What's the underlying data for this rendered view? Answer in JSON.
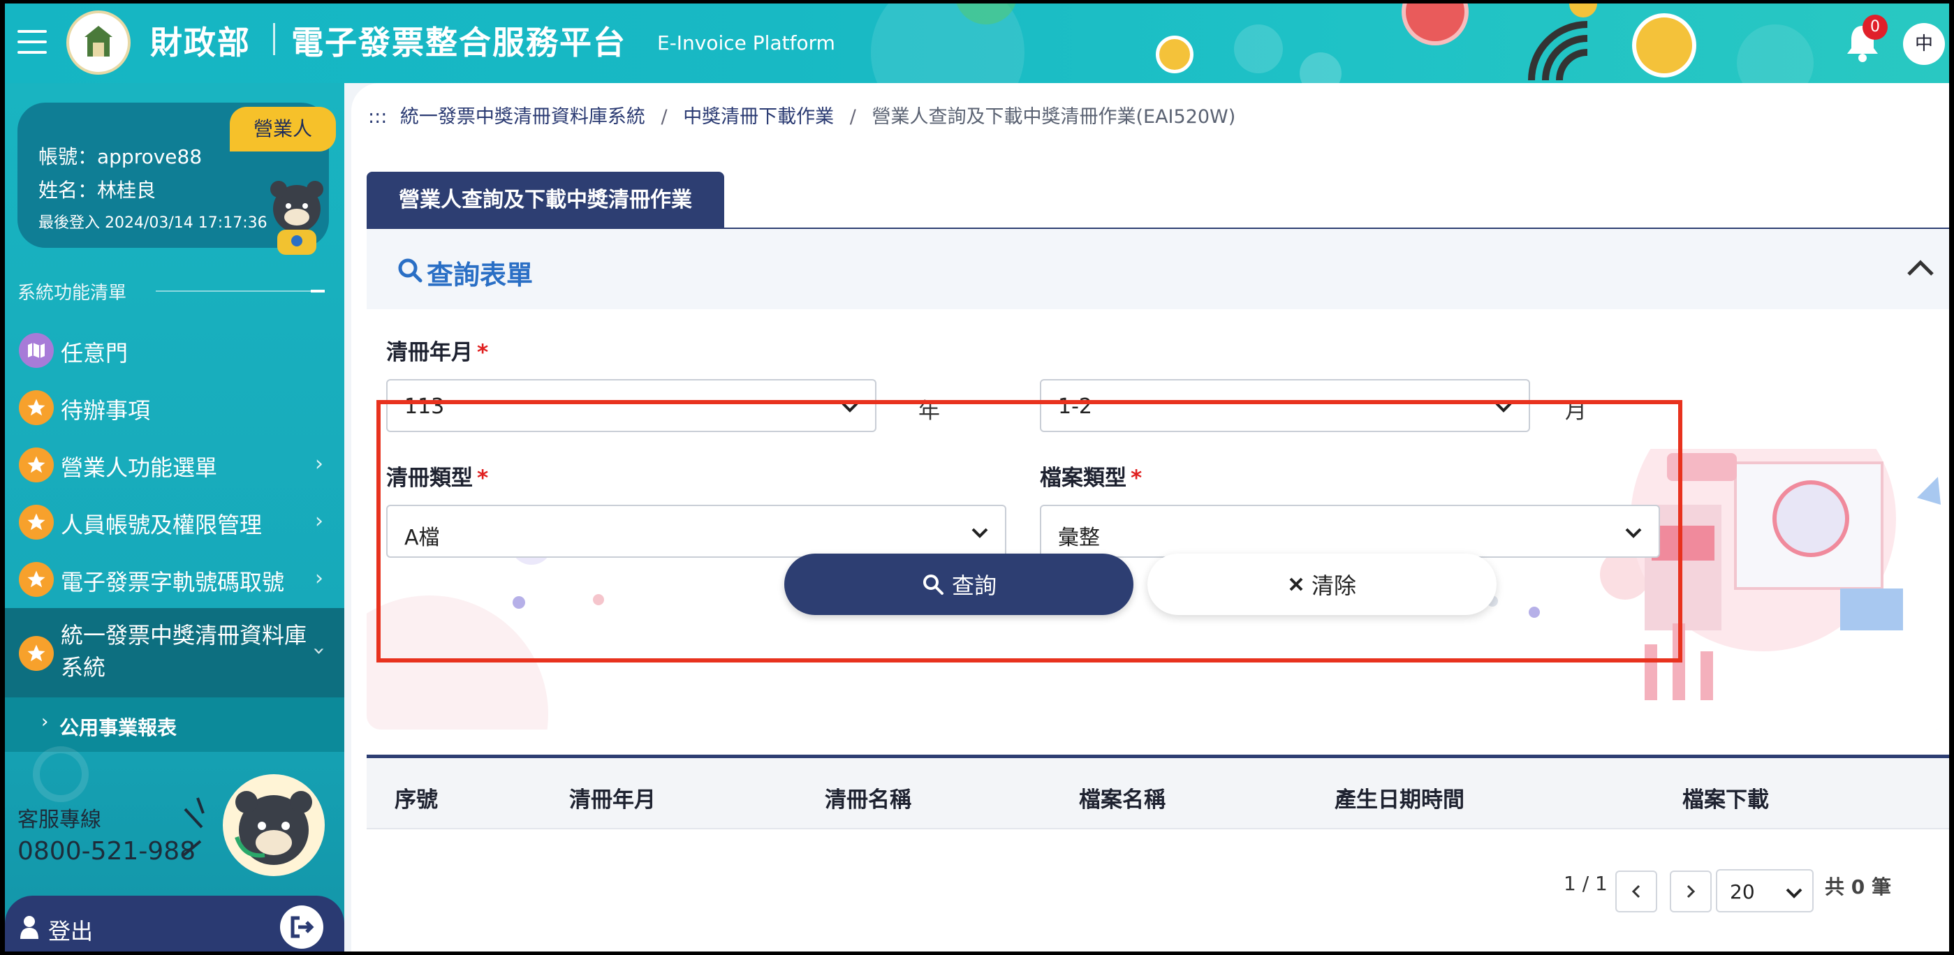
{
  "header": {
    "brand": "財政部",
    "platform": "電子發票整合服務平台",
    "platform_en": "E-Invoice Platform",
    "notification_count": "0",
    "language": "中"
  },
  "user": {
    "role": "營業人",
    "account": "帳號：approve88",
    "name": "姓名：林桂良",
    "last_login": "最後登入 2024/03/14 17:17:36"
  },
  "sidebar": {
    "menu_title": "系統功能清單",
    "items": [
      {
        "label": "任意門",
        "icon": "map-icon"
      },
      {
        "label": "待辦事項",
        "icon": "star-icon"
      },
      {
        "label": "營業人功能選單",
        "icon": "star-icon"
      },
      {
        "label": "人員帳號及權限管理",
        "icon": "star-icon"
      },
      {
        "label": "電子發票字軌號碼取號",
        "icon": "star-icon"
      },
      {
        "label_line1": "統一發票中獎清冊資料庫",
        "label_line2": "系統",
        "icon": "star-icon"
      }
    ],
    "submenu_item": "公用事業報表",
    "service_label": "客服專線",
    "service_phone": "0800-521-988",
    "logout": "登出"
  },
  "breadcrumb": {
    "prefix": ":::",
    "items": [
      "統一發票中獎清冊資料庫系統",
      "中獎清冊下載作業",
      "營業人查詢及下載中獎清冊作業(EAI520W)"
    ]
  },
  "page": {
    "tab": "營業人查詢及下載中獎清冊作業",
    "form_title": "查詢表單"
  },
  "form": {
    "period_label": "清冊年月",
    "year_value": "113",
    "year_unit": "年",
    "month_value": "1-2",
    "month_unit": "月",
    "list_type_label": "清冊類型",
    "list_type_value": "A檔",
    "file_type_label": "檔案類型",
    "file_type_value": "彙整",
    "required_mark": "*",
    "query_button": "查詢",
    "clear_button": "清除"
  },
  "table": {
    "columns": [
      "序號",
      "清冊年月",
      "清冊名稱",
      "檔案名稱",
      "產生日期時間",
      "檔案下載"
    ],
    "rows": []
  },
  "pagination": {
    "page_info": "1 / 1",
    "page_size": "20",
    "total_prefix": "共",
    "total_count": "0",
    "total_suffix": "筆"
  },
  "colors": {
    "header_teal": "#18b9c4",
    "navy": "#2d3e72",
    "highlight_red": "#e8321e",
    "accent_orange": "#f7a12c",
    "role_yellow": "#f6c12a"
  }
}
